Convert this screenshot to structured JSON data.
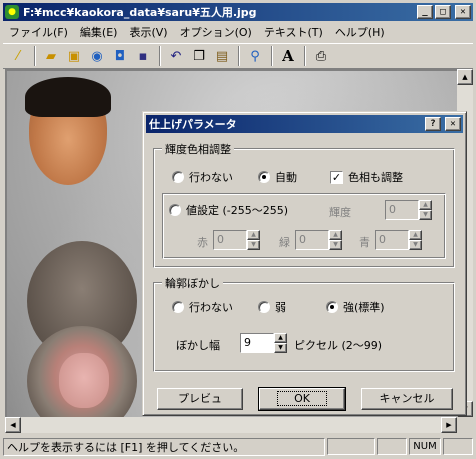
{
  "window": {
    "title": "F:¥mcc¥kaokora_data¥saru¥五人用.jpg",
    "app_icon": "app-icon",
    "minimize": "_",
    "maximize": "□",
    "close": "✕"
  },
  "menu": [
    {
      "label": "ファイル(F)"
    },
    {
      "label": "編集(E)"
    },
    {
      "label": "表示(V)"
    },
    {
      "label": "オプション(O)"
    },
    {
      "label": "テキスト(T)"
    },
    {
      "label": "ヘルプ(H)"
    }
  ],
  "toolbar": [
    {
      "icon": "magic-wand-icon",
      "glyph": "⁄"
    },
    {
      "icon": "open-folder-icon",
      "glyph": "▰"
    },
    {
      "icon": "open-multiple-icon",
      "glyph": "▣"
    },
    {
      "icon": "capture-icon",
      "glyph": "◉"
    },
    {
      "icon": "camera-icon",
      "glyph": "◘"
    },
    {
      "icon": "save-icon",
      "glyph": "▪"
    },
    {
      "icon": "undo-icon",
      "glyph": "↶"
    },
    {
      "icon": "copy-icon",
      "glyph": "❐"
    },
    {
      "icon": "paste-icon",
      "glyph": "▤"
    },
    {
      "icon": "zoom-icon",
      "glyph": "⚲"
    },
    {
      "icon": "text-icon",
      "glyph": "A"
    },
    {
      "icon": "print-icon",
      "glyph": "⎙"
    }
  ],
  "status": {
    "text": "ヘルプを表示するには [F1] を押してください。",
    "cells": [
      "",
      "",
      "NUM",
      ""
    ]
  },
  "dialog": {
    "title": "仕上げパラメータ",
    "help_button": "?",
    "close_button": "✕",
    "brightness_group": {
      "legend": "輝度色相調整",
      "options": [
        "行わない",
        "自動"
      ],
      "selected": "自動",
      "hue_checkbox": {
        "label": "色相も調整",
        "checked": true,
        "mark": "✓"
      },
      "value_option": "値設定 (-255〜255)",
      "brightness_label": "輝度",
      "red_label": "赤",
      "green_label": "緑",
      "blue_label": "青",
      "brightness_value": "0",
      "red_value": "0",
      "green_value": "0",
      "blue_value": "0"
    },
    "blur_group": {
      "legend": "輪郭ぼかし",
      "options": [
        "行わない",
        "弱",
        "強(標準)"
      ],
      "selected": "強(標準)",
      "width_label": "ぼかし幅",
      "width_value": "9",
      "unit_label": "ピクセル (2〜99)"
    },
    "buttons": {
      "preview": "プレビュ",
      "ok": "OK",
      "cancel": "キャンセル"
    }
  },
  "scroll_arrows": {
    "up": "▲",
    "down": "▼",
    "left": "◀",
    "right": "▶"
  }
}
